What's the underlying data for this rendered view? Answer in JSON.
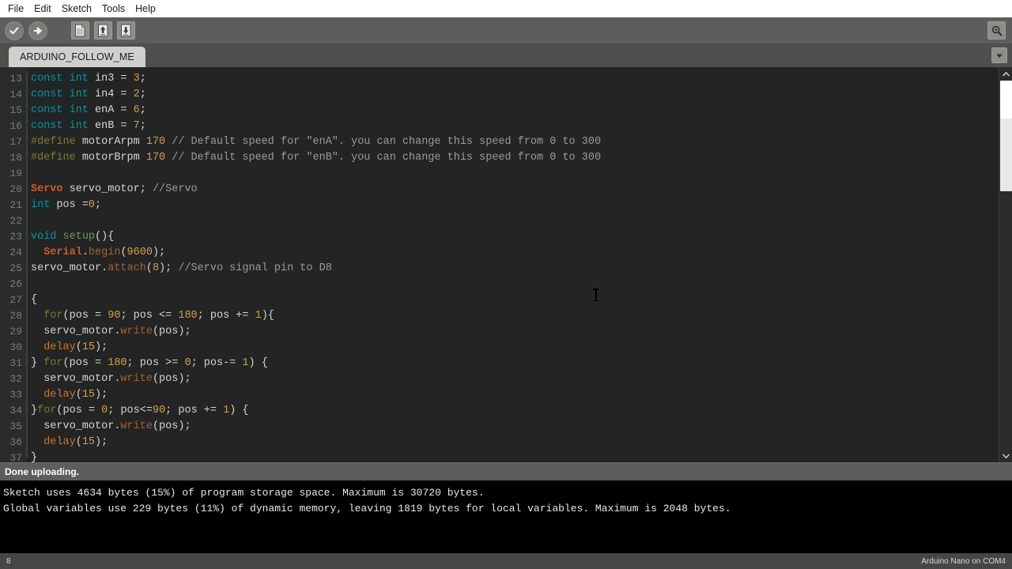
{
  "menubar": {
    "items": [
      {
        "label": "File",
        "name": "menu-file"
      },
      {
        "label": "Edit",
        "name": "menu-edit"
      },
      {
        "label": "Sketch",
        "name": "menu-sketch"
      },
      {
        "label": "Tools",
        "name": "menu-tools"
      },
      {
        "label": "Help",
        "name": "menu-help"
      }
    ]
  },
  "toolbar": {
    "verify": "verify-icon",
    "upload": "upload-icon",
    "new": "new-sketch-icon",
    "open": "open-sketch-icon",
    "save": "save-sketch-icon",
    "serial_monitor": "serial-monitor-icon"
  },
  "tabbar": {
    "active_tab": "ARDUINO_FOLLOW_ME",
    "menu_icon": "chevron-down-icon"
  },
  "editor": {
    "first_line_number": 13,
    "lines": [
      {
        "n": 13,
        "tokens": [
          {
            "t": "const int ",
            "c": "k-type"
          },
          {
            "t": "in3 = ",
            "c": "k-plain"
          },
          {
            "t": "3",
            "c": "k-num"
          },
          {
            "t": ";",
            "c": "k-plain"
          }
        ]
      },
      {
        "n": 14,
        "tokens": [
          {
            "t": "const int ",
            "c": "k-type"
          },
          {
            "t": "in4 = ",
            "c": "k-plain"
          },
          {
            "t": "2",
            "c": "k-num"
          },
          {
            "t": ";",
            "c": "k-plain"
          }
        ]
      },
      {
        "n": 15,
        "tokens": [
          {
            "t": "const int ",
            "c": "k-type"
          },
          {
            "t": "enA = ",
            "c": "k-plain"
          },
          {
            "t": "6",
            "c": "k-num"
          },
          {
            "t": ";",
            "c": "k-plain"
          }
        ]
      },
      {
        "n": 16,
        "tokens": [
          {
            "t": "const int ",
            "c": "k-type"
          },
          {
            "t": "enB = ",
            "c": "k-plain"
          },
          {
            "t": "7",
            "c": "k-num"
          },
          {
            "t": ";",
            "c": "k-plain"
          }
        ]
      },
      {
        "n": 17,
        "tokens": [
          {
            "t": "#define",
            "c": "k-pre"
          },
          {
            "t": " motorArpm ",
            "c": "k-plain"
          },
          {
            "t": "170",
            "c": "k-num"
          },
          {
            "t": " // Default speed for \"enA\". you can change this speed from 0 to 300",
            "c": "k-cmt"
          }
        ]
      },
      {
        "n": 18,
        "tokens": [
          {
            "t": "#define",
            "c": "k-pre"
          },
          {
            "t": " motorBrpm ",
            "c": "k-plain"
          },
          {
            "t": "170",
            "c": "k-num"
          },
          {
            "t": " // Default speed for \"enB\". you can change this speed from 0 to 300",
            "c": "k-cmt"
          }
        ]
      },
      {
        "n": 19,
        "tokens": []
      },
      {
        "n": 20,
        "tokens": [
          {
            "t": "Servo",
            "c": "k-cls"
          },
          {
            "t": " servo_motor; ",
            "c": "k-plain"
          },
          {
            "t": "//Servo",
            "c": "k-cmt"
          }
        ]
      },
      {
        "n": 21,
        "tokens": [
          {
            "t": "int",
            "c": "k-type"
          },
          {
            "t": " pos =",
            "c": "k-plain"
          },
          {
            "t": "0",
            "c": "k-num"
          },
          {
            "t": ";",
            "c": "k-plain"
          }
        ]
      },
      {
        "n": 22,
        "tokens": []
      },
      {
        "n": 23,
        "tokens": [
          {
            "t": "void",
            "c": "k-type"
          },
          {
            "t": " ",
            "c": "k-plain"
          },
          {
            "t": "setup",
            "c": "k-fn"
          },
          {
            "t": "(){",
            "c": "k-plain"
          }
        ]
      },
      {
        "n": 24,
        "tokens": [
          {
            "t": "  ",
            "c": "k-plain"
          },
          {
            "t": "Serial",
            "c": "k-cls"
          },
          {
            "t": ".",
            "c": "k-plain"
          },
          {
            "t": "begin",
            "c": "k-meth"
          },
          {
            "t": "(",
            "c": "k-plain"
          },
          {
            "t": "9600",
            "c": "k-num"
          },
          {
            "t": ");",
            "c": "k-plain"
          }
        ]
      },
      {
        "n": 25,
        "tokens": [
          {
            "t": "servo_motor.",
            "c": "k-plain"
          },
          {
            "t": "attach",
            "c": "k-meth"
          },
          {
            "t": "(",
            "c": "k-plain"
          },
          {
            "t": "8",
            "c": "k-num"
          },
          {
            "t": "); ",
            "c": "k-plain"
          },
          {
            "t": "//Servo signal pin to D8",
            "c": "k-cmt"
          }
        ]
      },
      {
        "n": 26,
        "tokens": []
      },
      {
        "n": 27,
        "tokens": [
          {
            "t": "{",
            "c": "k-plain"
          }
        ]
      },
      {
        "n": 28,
        "tokens": [
          {
            "t": "  ",
            "c": "k-plain"
          },
          {
            "t": "for",
            "c": "k-for"
          },
          {
            "t": "(pos = ",
            "c": "k-plain"
          },
          {
            "t": "90",
            "c": "k-num"
          },
          {
            "t": "; pos <= ",
            "c": "k-plain"
          },
          {
            "t": "180",
            "c": "k-num"
          },
          {
            "t": "; pos += ",
            "c": "k-plain"
          },
          {
            "t": "1",
            "c": "k-num"
          },
          {
            "t": "){",
            "c": "k-plain"
          }
        ]
      },
      {
        "n": 29,
        "tokens": [
          {
            "t": "  servo_motor.",
            "c": "k-plain"
          },
          {
            "t": "write",
            "c": "k-meth"
          },
          {
            "t": "(pos);",
            "c": "k-plain"
          }
        ]
      },
      {
        "n": 30,
        "tokens": [
          {
            "t": "  ",
            "c": "k-plain"
          },
          {
            "t": "delay",
            "c": "k-delay"
          },
          {
            "t": "(",
            "c": "k-plain"
          },
          {
            "t": "15",
            "c": "k-num"
          },
          {
            "t": ");",
            "c": "k-plain"
          }
        ]
      },
      {
        "n": 31,
        "tokens": [
          {
            "t": "} ",
            "c": "k-plain"
          },
          {
            "t": "for",
            "c": "k-for"
          },
          {
            "t": "(pos = ",
            "c": "k-plain"
          },
          {
            "t": "180",
            "c": "k-num"
          },
          {
            "t": "; pos >= ",
            "c": "k-plain"
          },
          {
            "t": "0",
            "c": "k-num"
          },
          {
            "t": "; pos-= ",
            "c": "k-plain"
          },
          {
            "t": "1",
            "c": "k-num"
          },
          {
            "t": ") {",
            "c": "k-plain"
          }
        ]
      },
      {
        "n": 32,
        "tokens": [
          {
            "t": "  servo_motor.",
            "c": "k-plain"
          },
          {
            "t": "write",
            "c": "k-meth"
          },
          {
            "t": "(pos);",
            "c": "k-plain"
          }
        ]
      },
      {
        "n": 33,
        "tokens": [
          {
            "t": "  ",
            "c": "k-plain"
          },
          {
            "t": "delay",
            "c": "k-delay"
          },
          {
            "t": "(",
            "c": "k-plain"
          },
          {
            "t": "15",
            "c": "k-num"
          },
          {
            "t": ");",
            "c": "k-plain"
          }
        ]
      },
      {
        "n": 34,
        "tokens": [
          {
            "t": "}",
            "c": "k-plain"
          },
          {
            "t": "for",
            "c": "k-for"
          },
          {
            "t": "(pos = ",
            "c": "k-plain"
          },
          {
            "t": "0",
            "c": "k-num"
          },
          {
            "t": "; pos<=",
            "c": "k-plain"
          },
          {
            "t": "90",
            "c": "k-num"
          },
          {
            "t": "; pos += ",
            "c": "k-plain"
          },
          {
            "t": "1",
            "c": "k-num"
          },
          {
            "t": ") {",
            "c": "k-plain"
          }
        ]
      },
      {
        "n": 35,
        "tokens": [
          {
            "t": "  servo_motor.",
            "c": "k-plain"
          },
          {
            "t": "write",
            "c": "k-meth"
          },
          {
            "t": "(pos);",
            "c": "k-plain"
          }
        ]
      },
      {
        "n": 36,
        "tokens": [
          {
            "t": "  ",
            "c": "k-plain"
          },
          {
            "t": "delay",
            "c": "k-delay"
          },
          {
            "t": "(",
            "c": "k-plain"
          },
          {
            "t": "15",
            "c": "k-num"
          },
          {
            "t": ");",
            "c": "k-plain"
          }
        ]
      },
      {
        "n": 37,
        "tokens": [
          {
            "t": "}",
            "c": "k-plain"
          }
        ]
      }
    ]
  },
  "status": {
    "message": "Done uploading."
  },
  "console": {
    "lines": [
      "Sketch uses 4634 bytes (15%) of program storage space. Maximum is 30720 bytes.",
      "Global variables use 229 bytes (11%) of dynamic memory, leaving 1819 bytes for local variables. Maximum is 2048 bytes."
    ]
  },
  "footer": {
    "line_number": "8",
    "board_info": "Arduino Nano on COM4"
  },
  "colors": {
    "toolbar_bg": "#5d5e5b",
    "tabbar_bg": "#4f504d",
    "editor_bg": "#232424",
    "console_bg": "#000000",
    "footer_bg": "#464744",
    "accent_teal": "#00979c",
    "accent_orange": "#cf5a23"
  }
}
